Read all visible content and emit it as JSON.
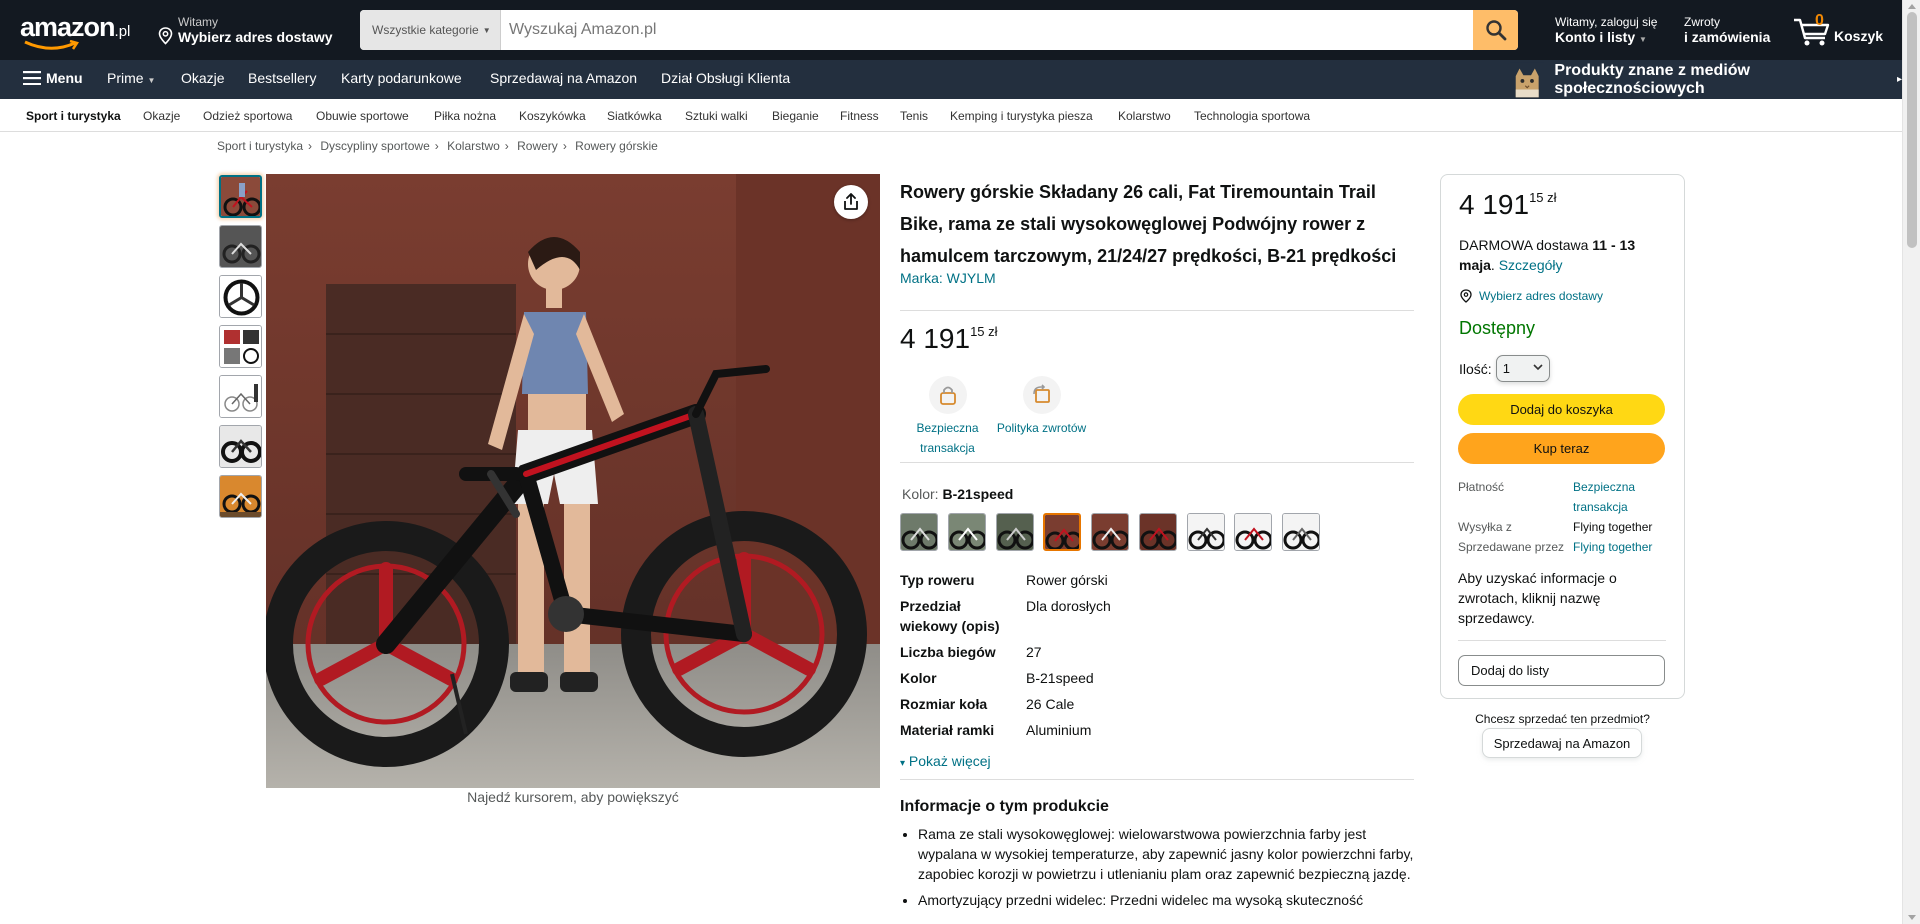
{
  "header": {
    "logo_text": "amazon",
    "logo_tld": ".pl",
    "deliver_line1": "Witamy",
    "deliver_line2": "Wybierz adres dostawy",
    "search_category": "Wszystkie kategorie",
    "search_placeholder": "Wyszukaj Amazon.pl",
    "account_line1": "Witamy, zaloguj się",
    "account_line2": "Konto i listy",
    "returns_line1": "Zwroty",
    "returns_line2": "i zamówienia",
    "cart_count": "0",
    "cart_label": "Koszyk"
  },
  "main_nav": {
    "menu": "Menu",
    "items": [
      "Prime",
      "Okazje",
      "Bestsellery",
      "Karty podarunkowe",
      "Sprzedawaj na Amazon",
      "Dział Obsługi Klienta"
    ],
    "promo": "Produkty znane z mediów społecznościowych"
  },
  "sub_nav": [
    "Sport i turystyka",
    "Okazje",
    "Odzież sportowa",
    "Obuwie sportowe",
    "Piłka nożna",
    "Koszykówka",
    "Siatkówka",
    "Sztuki walki",
    "Bieganie",
    "Fitness",
    "Tenis",
    "Kemping i turystyka piesza",
    "Kolarstwo",
    "Technologia sportowa"
  ],
  "breadcrumb": [
    "Sport i turystyka",
    "Dyscypliny sportowe",
    "Kolarstwo",
    "Rowery",
    "Rowery górskie"
  ],
  "gallery": {
    "zoom_hint": "Najedź kursorem, aby powiększyć"
  },
  "product": {
    "title": "Rowery górskie Składany 26 cali, Fat Tiremountain Trail Bike, rama ze stali wysokowęglowej Podwójny rower z hamulcem tarczowym, 21/24/27 prędkości, B-21 prędkości",
    "brand": "Marka: WJYLM",
    "price_whole": "4 191",
    "price_frac": "15 zł",
    "badge_secure": "Bezpieczna transakcja",
    "badge_returns": "Polityka zwrotów",
    "color_label": "Kolor:",
    "color_value": "B-21speed",
    "specs": [
      {
        "k": "Typ roweru",
        "v": "Rower górski"
      },
      {
        "k": "Przedział wiekowy (opis)",
        "v": "Dla dorosłych"
      },
      {
        "k": "Liczba biegów",
        "v": "27"
      },
      {
        "k": "Kolor",
        "v": "B-21speed"
      },
      {
        "k": "Rozmiar koła",
        "v": "26 Cale"
      },
      {
        "k": "Materiał ramki",
        "v": "Aluminium"
      }
    ],
    "show_more": "Pokaż więcej",
    "about_heading": "Informacje o tym produkcie",
    "about": [
      "Rama ze stali wysokowęglowej: wielowarstwowa powierzchnia farby jest wypalana w wysokiej temperaturze, aby zapewnić jasny kolor powierzchni farby, zapobiec korozji w powietrzu i utlenianiu plam oraz zapewnić bezpieczną jazdę.",
      "Amortyzujący przedni widelec: Przedni widelec ma wysoką skuteczność"
    ]
  },
  "buybox": {
    "price_whole": "4 191",
    "price_frac": "15 zł",
    "delivery_prefix": "DARMOWA dostawa",
    "delivery_date": "11 - 13 maja",
    "delivery_details": "Szczegóły",
    "address": "Wybierz adres dostawy",
    "stock": "Dostępny",
    "qty_label": "Ilość:",
    "qty_value": "1",
    "add_to_cart": "Dodaj do koszyka",
    "buy_now": "Kup teraz",
    "payment_k": "Płatność",
    "payment_v": "Bezpieczna transakcja",
    "ships_k": "Wysyłka z",
    "ships_v": "Flying together",
    "sold_k": "Sprzedawane przez",
    "sold_v": "Flying together",
    "returns_text": "Aby uzyskać informacje o zwrotach, kliknij nazwę sprzedawcy.",
    "add_to_list": "Dodaj do listy",
    "sell_question": "Chcesz sprzedać ten przedmiot?",
    "sell_button": "Sprzedawaj na Amazon"
  }
}
